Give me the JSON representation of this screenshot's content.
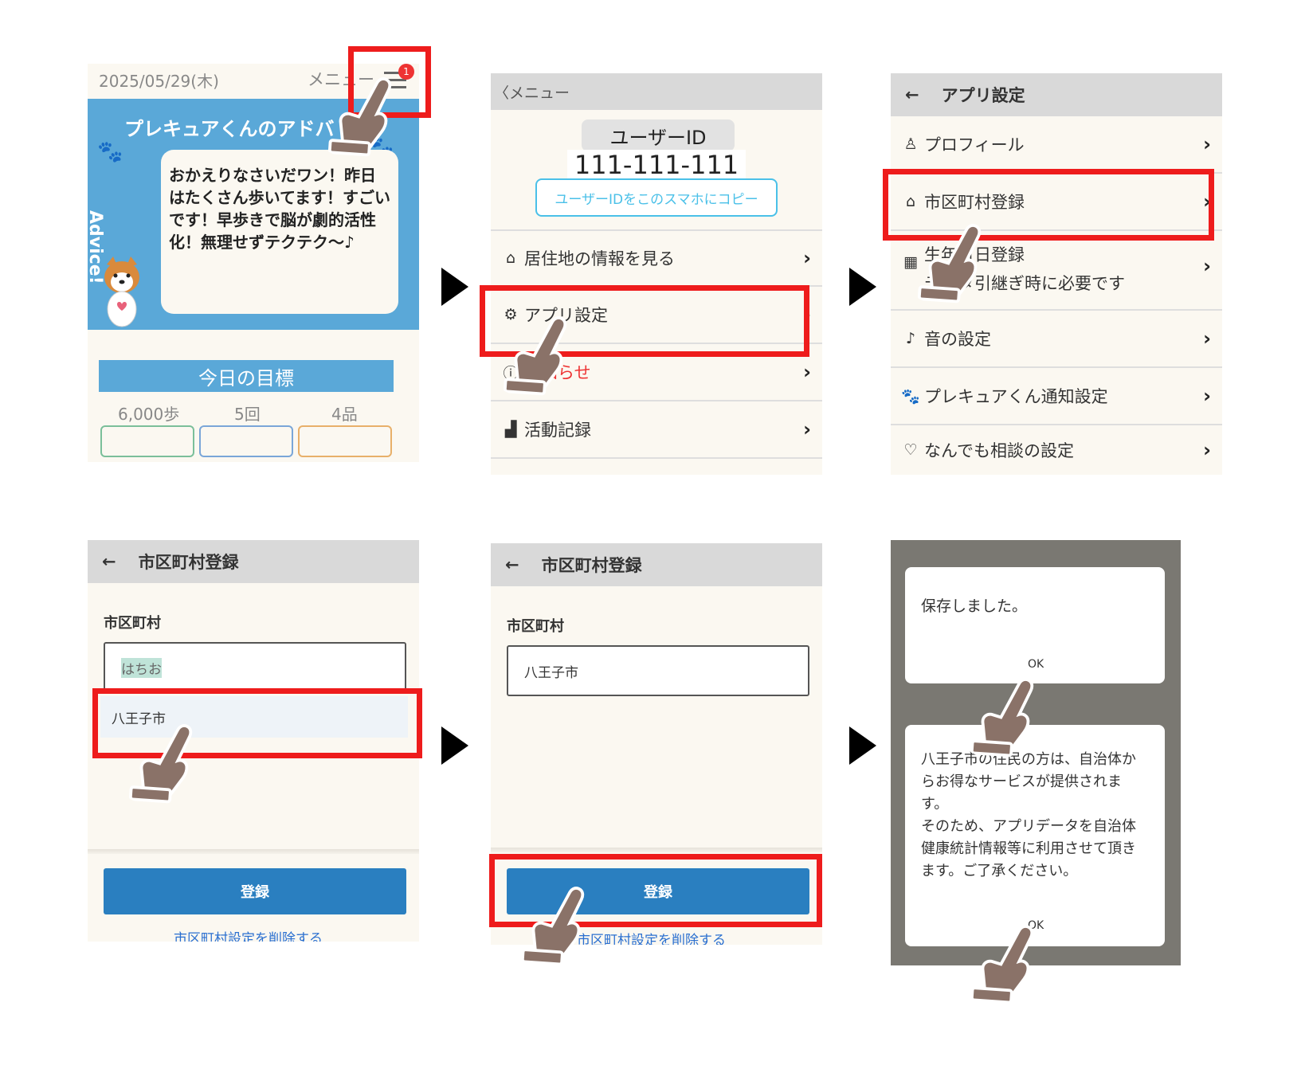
{
  "screen1": {
    "date": "2025/05/29(木)",
    "menu_label": "メニュー",
    "badge": "1",
    "advice_header": "プレキュアくんのアドバ",
    "advice_tab": "Advice!",
    "advice_text": "おかえりなさいだワン！昨日はたくさん歩いてます！すごいです！早歩きで脳が劇的活性化！無理せずテクテク〜♪",
    "goal_title": "今日の目標",
    "goals": [
      "6,000歩",
      "5回",
      "4品"
    ]
  },
  "screen2": {
    "back_label": "〈メニュー",
    "user_id_label": "ユーザーID",
    "user_id": "111-111-111",
    "copy_button": "ユーザーIDをこのスマホにコピー",
    "items": [
      {
        "icon": "house-icon",
        "label": "居住地の情報を見る"
      },
      {
        "icon": "gear-icon",
        "label": "アプリ設定"
      },
      {
        "icon": "info-icon",
        "label": "お知らせ"
      },
      {
        "icon": "chart-icon",
        "label": "活動記録"
      }
    ]
  },
  "screen3": {
    "back_arrow": "←",
    "title": "アプリ設定",
    "items": [
      {
        "icon": "person-icon",
        "label": "プロフィール"
      },
      {
        "icon": "house-icon",
        "label": "市区町村登録"
      },
      {
        "icon": "calendar-icon",
        "label": "生年月日登録",
        "sub": "データ引継ぎ時に必要です"
      },
      {
        "icon": "note-icon",
        "label": "音の設定"
      },
      {
        "icon": "paw-icon",
        "label": "プレキュアくん通知設定"
      },
      {
        "icon": "heart-icon",
        "label": "なんでも相談の設定"
      }
    ]
  },
  "screen4": {
    "back_arrow": "←",
    "title": "市区町村登録",
    "field_label": "市区町村",
    "input_value": "はちお",
    "suggestion": "八王子市",
    "register_button": "登録",
    "delete_link": "市区町村設定を削除する"
  },
  "screen5": {
    "back_arrow": "←",
    "title": "市区町村登録",
    "field_label": "市区町村",
    "input_value": "八王子市",
    "register_button": "登録",
    "delete_link": "市区町村設定を削除する"
  },
  "screen6": {
    "saved_message": "保存しました。",
    "ok1": "OK",
    "notice_lines": [
      "八王子市の住民の方は、自治体か",
      "らお得なサービスが提供されま",
      "す。",
      "そのため、アプリデータを自治体",
      "健康統計情報等に利用させて頂き",
      "ます。ご了承ください。"
    ],
    "ok2": "OK"
  },
  "colors": {
    "highlight": "#ee1c1c",
    "header_gray": "#d9d9d9",
    "advice_blue": "#5aa8d8",
    "button_blue": "#2a7fc0",
    "dialog_overlay": "#7a7872",
    "link_blue": "#2a6fd0",
    "hand": "#8a7268"
  }
}
